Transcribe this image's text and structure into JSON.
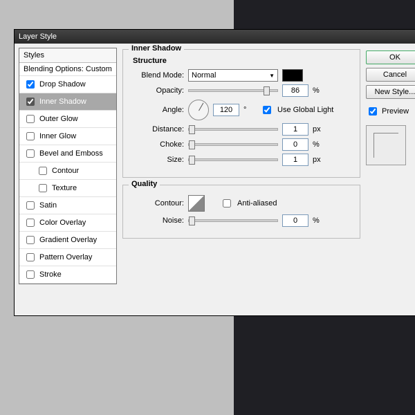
{
  "window": {
    "title": "Layer Style"
  },
  "styles": {
    "header": "Styles",
    "blending": "Blending Options: Custom",
    "items": [
      {
        "label": "Drop Shadow",
        "checked": true,
        "sel": false
      },
      {
        "label": "Inner Shadow",
        "checked": true,
        "sel": true
      },
      {
        "label": "Outer Glow",
        "checked": false
      },
      {
        "label": "Inner Glow",
        "checked": false
      },
      {
        "label": "Bevel and Emboss",
        "checked": false
      },
      {
        "label": "Contour",
        "checked": false,
        "indent": true
      },
      {
        "label": "Texture",
        "checked": false,
        "indent": true
      },
      {
        "label": "Satin",
        "checked": false
      },
      {
        "label": "Color Overlay",
        "checked": false
      },
      {
        "label": "Gradient Overlay",
        "checked": false
      },
      {
        "label": "Pattern Overlay",
        "checked": false
      },
      {
        "label": "Stroke",
        "checked": false
      }
    ]
  },
  "panel": {
    "title": "Inner Shadow",
    "structure": {
      "title": "Structure",
      "blendModeLabel": "Blend Mode:",
      "blendModeValue": "Normal",
      "opacityLabel": "Opacity:",
      "opacityValue": "86",
      "opacityUnit": "%",
      "angleLabel": "Angle:",
      "angleValue": "120",
      "angleUnit": "°",
      "globalLightLabel": "Use Global Light",
      "distanceLabel": "Distance:",
      "distanceValue": "1",
      "distanceUnit": "px",
      "chokeLabel": "Choke:",
      "chokeValue": "0",
      "chokeUnit": "%",
      "sizeLabel": "Size:",
      "sizeValue": "1",
      "sizeUnit": "px"
    },
    "quality": {
      "title": "Quality",
      "contourLabel": "Contour:",
      "antialiasLabel": "Anti-aliased",
      "noiseLabel": "Noise:",
      "noiseValue": "0",
      "noiseUnit": "%"
    }
  },
  "buttons": {
    "ok": "OK",
    "cancel": "Cancel",
    "newStyle": "New Style...",
    "preview": "Preview"
  },
  "colors": {
    "shadow": "#000000"
  }
}
